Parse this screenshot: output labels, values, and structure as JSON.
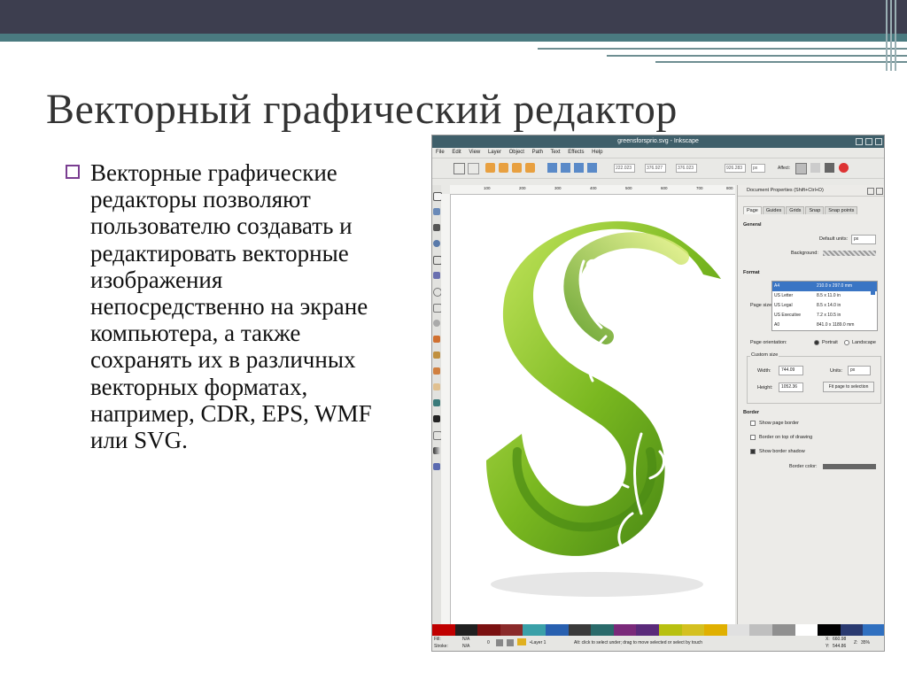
{
  "slide": {
    "title": "Векторный графический редактор",
    "bullet": "Векторные графические редакторы позволяют пользователю создавать и редактировать векторные изображения непосредственно на экране компьютера, а также сохранять их в различных векторных форматах, например, CDR, EPS, WMF или SVG."
  },
  "window": {
    "title": "greensforsprio.svg - Inkscape",
    "menu": [
      "File",
      "Edit",
      "View",
      "Layer",
      "Object",
      "Path",
      "Text",
      "Effects",
      "Help"
    ],
    "toolbar_fields": [
      "222.023",
      "376.927",
      "376.023",
      "926.283"
    ],
    "unit": "px",
    "affect_label": "Affect:"
  },
  "ruler": {
    "ticks": [
      "100",
      "200",
      "300",
      "400",
      "500",
      "600",
      "700",
      "800"
    ]
  },
  "dialog": {
    "title": "Document Properties (Shift+Ctrl+D)",
    "tabs": [
      "Page",
      "Guides",
      "Grids",
      "Snap",
      "Snap points"
    ],
    "general_heading": "General",
    "default_units_label": "Default units:",
    "default_units_value": "px",
    "background_label": "Background:",
    "format_heading": "Format",
    "page_size_label": "Page size:",
    "formats": [
      {
        "name": "A4",
        "dims": "210.0 x 297.0 mm"
      },
      {
        "name": "US Letter",
        "dims": "8.5 x 11.0 in"
      },
      {
        "name": "US Legal",
        "dims": "8.5 x 14.0 in"
      },
      {
        "name": "US Executive",
        "dims": "7.2 x 10.5 in"
      },
      {
        "name": "A0",
        "dims": "841.0 x 1189.0 mm"
      }
    ],
    "orientation_label": "Page orientation:",
    "portrait_label": "Portrait",
    "landscape_label": "Landscape",
    "custom_size_label": "Custom size",
    "width_label": "Width:",
    "width_value": "744.09",
    "height_label": "Height:",
    "height_value": "1052.36",
    "units_label": "Units:",
    "units_value": "px",
    "fit_button": "Fit page to selection",
    "border_heading": "Border",
    "show_page_border": "Show page border",
    "border_on_top": "Border on top of drawing",
    "show_border_shadow": "Show border shadow",
    "border_color_label": "Border color:",
    "border_color": "#666666"
  },
  "status": {
    "fill_label": "Fill:",
    "stroke_label": "Stroke:",
    "fill_value": "N/A",
    "stroke_value": "N/A",
    "opacity_value": "0",
    "layer": "•Layer 1",
    "message": "Alt: click to select under; drag to move selected or select by touch",
    "x_label": "X:",
    "x_value": "660.98",
    "y_label": "Y:",
    "y_value": "544.86",
    "z_label": "Z:",
    "zoom": "35%"
  },
  "colors": {
    "palette": [
      "#c00000",
      "#202020",
      "#7a1010",
      "#8a2a2a",
      "#3aa0a8",
      "#2860b0",
      "#3a3a3a",
      "#2a6a6a",
      "#7a2a7a",
      "#5a2a7a",
      "#b8c010",
      "#d4c020",
      "#e0b000",
      "#e0e0e0",
      "#bfbfbf",
      "#909090",
      "#ffffff",
      "#000000",
      "#2a3a70",
      "#3070c0"
    ]
  }
}
